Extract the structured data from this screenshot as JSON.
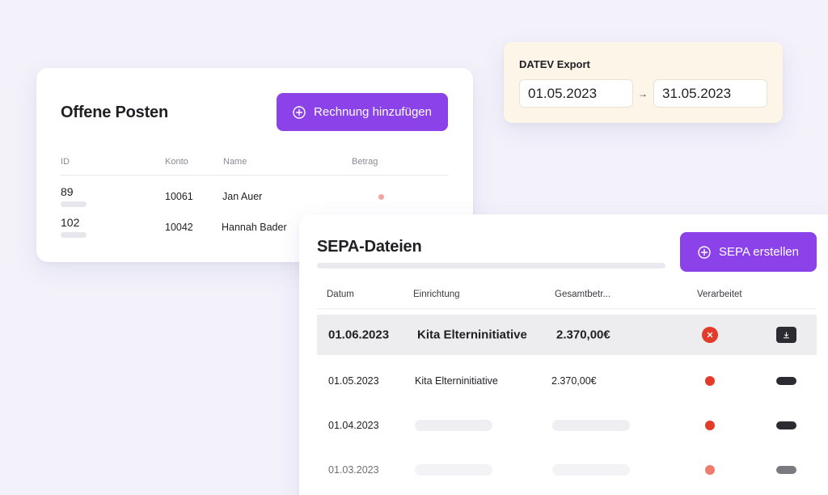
{
  "offene_posten": {
    "title": "Offene Posten",
    "add_button_label": "Rechnung hinzufügen",
    "columns": [
      "ID",
      "Konto",
      "Name",
      "Betrag"
    ],
    "rows": [
      {
        "id": "89",
        "konto": "10061",
        "name": "Jan Auer"
      },
      {
        "id": "102",
        "konto": "10042",
        "name": "Hannah Bader"
      }
    ]
  },
  "datev": {
    "title": "DATEV Export",
    "date_from": "01.05.2023",
    "date_to": "31.05.2023",
    "arrow": "→"
  },
  "sepa": {
    "title": "SEPA-Dateien",
    "create_button_label": "SEPA erstellen",
    "columns": [
      "Datum",
      "Einrichtung",
      "Gesamtbetr...",
      "Verarbeitet"
    ],
    "rows": [
      {
        "datum": "01.06.2023",
        "einrichtung": "Kita Elterninitiative",
        "betrag": "2.370,00€"
      },
      {
        "datum": "01.05.2023",
        "einrichtung": "Kita Elterninitiative",
        "betrag": "2.370,00€"
      },
      {
        "datum": "01.04.2023"
      },
      {
        "datum": "01.03.2023"
      }
    ]
  },
  "colors": {
    "accent": "#8b42e8",
    "background": "#f3f2fb",
    "status_red": "#e33b2a",
    "status_light_red": "#f07a6c",
    "datev_bg": "#fdf5e8"
  }
}
